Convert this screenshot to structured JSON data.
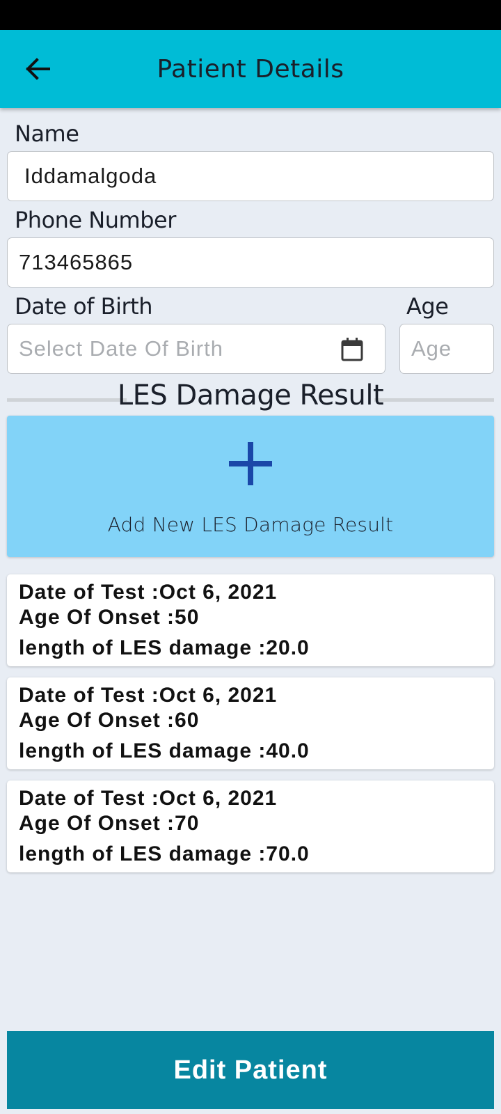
{
  "header": {
    "title": "Patient Details"
  },
  "form": {
    "name": {
      "label": "Name",
      "value": "Iddamalgoda"
    },
    "phone": {
      "label": "Phone Number",
      "value": "713465865"
    },
    "dob": {
      "label": "Date of Birth",
      "placeholder": "Select Date Of Birth"
    },
    "age": {
      "label": "Age",
      "placeholder": "Age"
    }
  },
  "section": {
    "title": "LES Damage Result",
    "add_label": "Add New LES Damage Result"
  },
  "results": [
    {
      "date": "Date of Test :Oct 6, 2021",
      "onset": "Age Of Onset :50",
      "length": "length of LES damage :20.0"
    },
    {
      "date": "Date of Test :Oct 6, 2021",
      "onset": "Age Of Onset :60",
      "length": "length of LES damage :40.0"
    },
    {
      "date": "Date of Test :Oct 6, 2021",
      "onset": "Age Of Onset :70",
      "length": "length of LES damage :70.0"
    }
  ],
  "footer": {
    "edit_label": "Edit Patient"
  },
  "colors": {
    "app_bar": "#00bcd6",
    "add_card": "#82d3f8",
    "plus": "#1a47a8",
    "edit_button": "#0786a0",
    "background": "#e8edf4"
  },
  "icons": {
    "back": "arrow-left-icon",
    "calendar": "calendar-icon",
    "add": "plus-icon"
  }
}
